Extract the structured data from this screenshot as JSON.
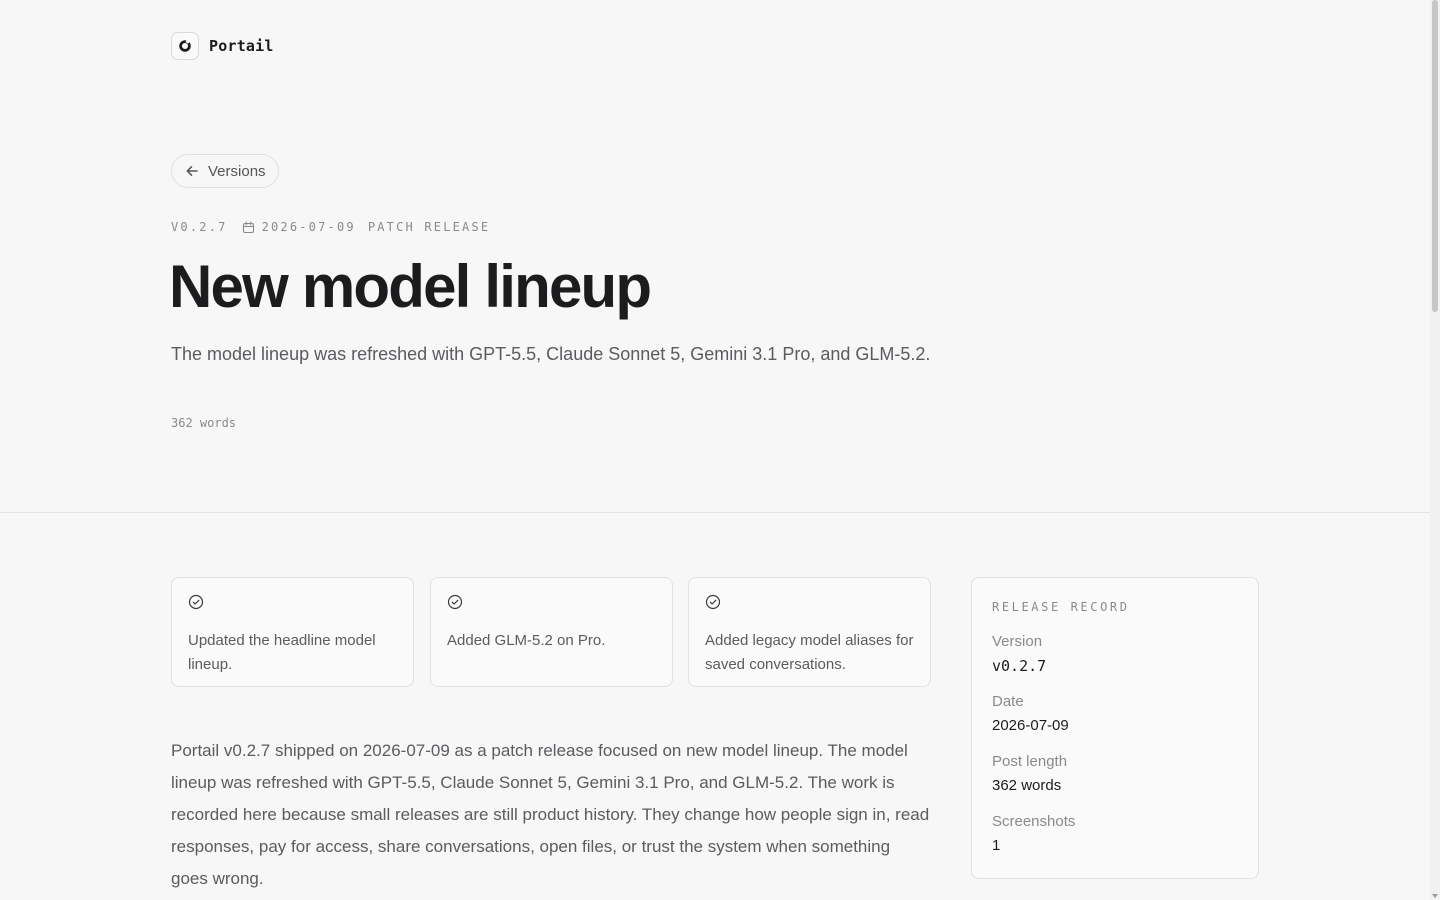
{
  "header": {
    "brand_name": "Portail"
  },
  "nav": {
    "back_label": "Versions"
  },
  "release": {
    "version": "V0.2.7",
    "date": "2026-07-09",
    "type": "PATCH RELEASE",
    "title": "New model lineup",
    "summary": "The model lineup was refreshed with GPT-5.5, Claude Sonnet 5, Gemini 3.1 Pro, and GLM-5.2.",
    "word_count": "362 words"
  },
  "highlights": [
    {
      "text": "Updated the headline model lineup."
    },
    {
      "text": "Added GLM-5.2 on Pro."
    },
    {
      "text": "Added legacy model aliases for saved conversations."
    }
  ],
  "body": {
    "paragraph": "Portail v0.2.7 shipped on 2026-07-09 as a patch release focused on new model lineup. The model lineup was refreshed with GPT-5.5, Claude Sonnet 5, Gemini 3.1 Pro, and GLM-5.2. The work is recorded here because small releases are still product history. They change how people sign in, read responses, pay for access, share conversations, open files, or trust the system when something goes wrong."
  },
  "record": {
    "heading": "RELEASE RECORD",
    "items": [
      {
        "label": "Version",
        "value": "v0.2.7"
      },
      {
        "label": "Date",
        "value": "2026-07-09"
      },
      {
        "label": "Post length",
        "value": "362 words"
      },
      {
        "label": "Screenshots",
        "value": "1"
      }
    ]
  },
  "icons": {
    "logo": "portail-logo-icon",
    "back": "arrow-left-icon",
    "date": "calendar-icon",
    "highlight": "check-circle-icon"
  }
}
